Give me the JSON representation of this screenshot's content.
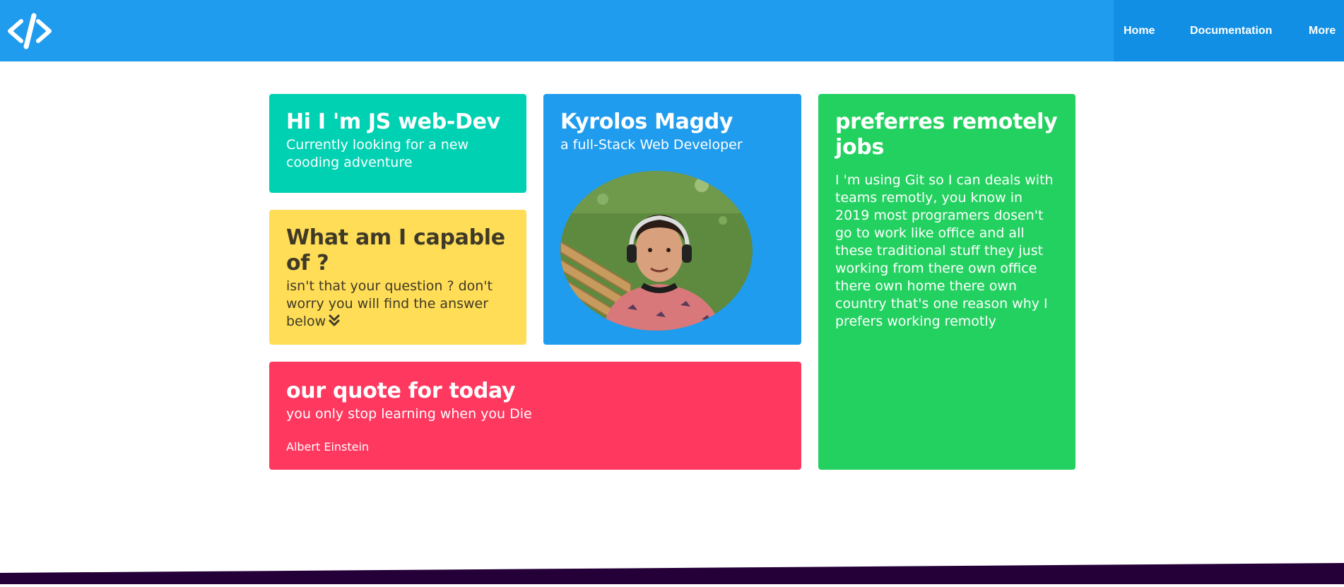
{
  "nav": {
    "logo_icon": "code-icon",
    "items": [
      {
        "label": "Home"
      },
      {
        "label": "Documentation"
      },
      {
        "label": "More"
      }
    ],
    "colors": {
      "bar": "#209cee",
      "menu": "#118fe4"
    }
  },
  "tiles": {
    "hello": {
      "title": "Hi I 'm JS web-Dev",
      "subtitle": "Currently looking for a new cooding adventure",
      "color": "#00d1b2"
    },
    "capable": {
      "title": "What am I capable of ?",
      "subtitle": "isn't that your question ? don't worry you will find the answer below",
      "icon": "double-chevron-down-icon",
      "color": "#ffdd57"
    },
    "profile": {
      "title": "Kyrolos Magdy",
      "subtitle": "a full-Stack Web Developer",
      "avatar": "profile-photo",
      "color": "#209cee"
    },
    "quote": {
      "title": "our quote for today",
      "text": "you only stop learning when you Die",
      "author": "Albert Einstein",
      "color": "#ff3860"
    },
    "remote": {
      "title": "preferres remotely jobs",
      "text": "I 'm using Git so I can deals with teams remotly, you know in 2019 most programers dosen't go to work like office and all these traditional stuff they just working from there own office there own home there own country that's one reason why I prefers working remotly",
      "color": "#23d160"
    }
  }
}
